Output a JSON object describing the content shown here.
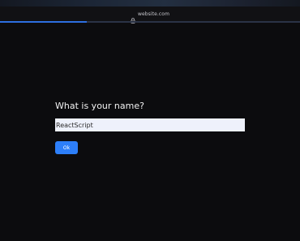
{
  "browser": {
    "url": "website.com",
    "lock_icon": "lock-icon",
    "load_progress": 0.29
  },
  "dialog": {
    "prompt": "What is your name?",
    "input_value": "ReactScript",
    "ok_label": "Ok"
  },
  "colors": {
    "background": "#0c0c0e",
    "accent": "#2d7ff9",
    "progress": "#2d6fe0",
    "input_background": "#eef1fb"
  }
}
